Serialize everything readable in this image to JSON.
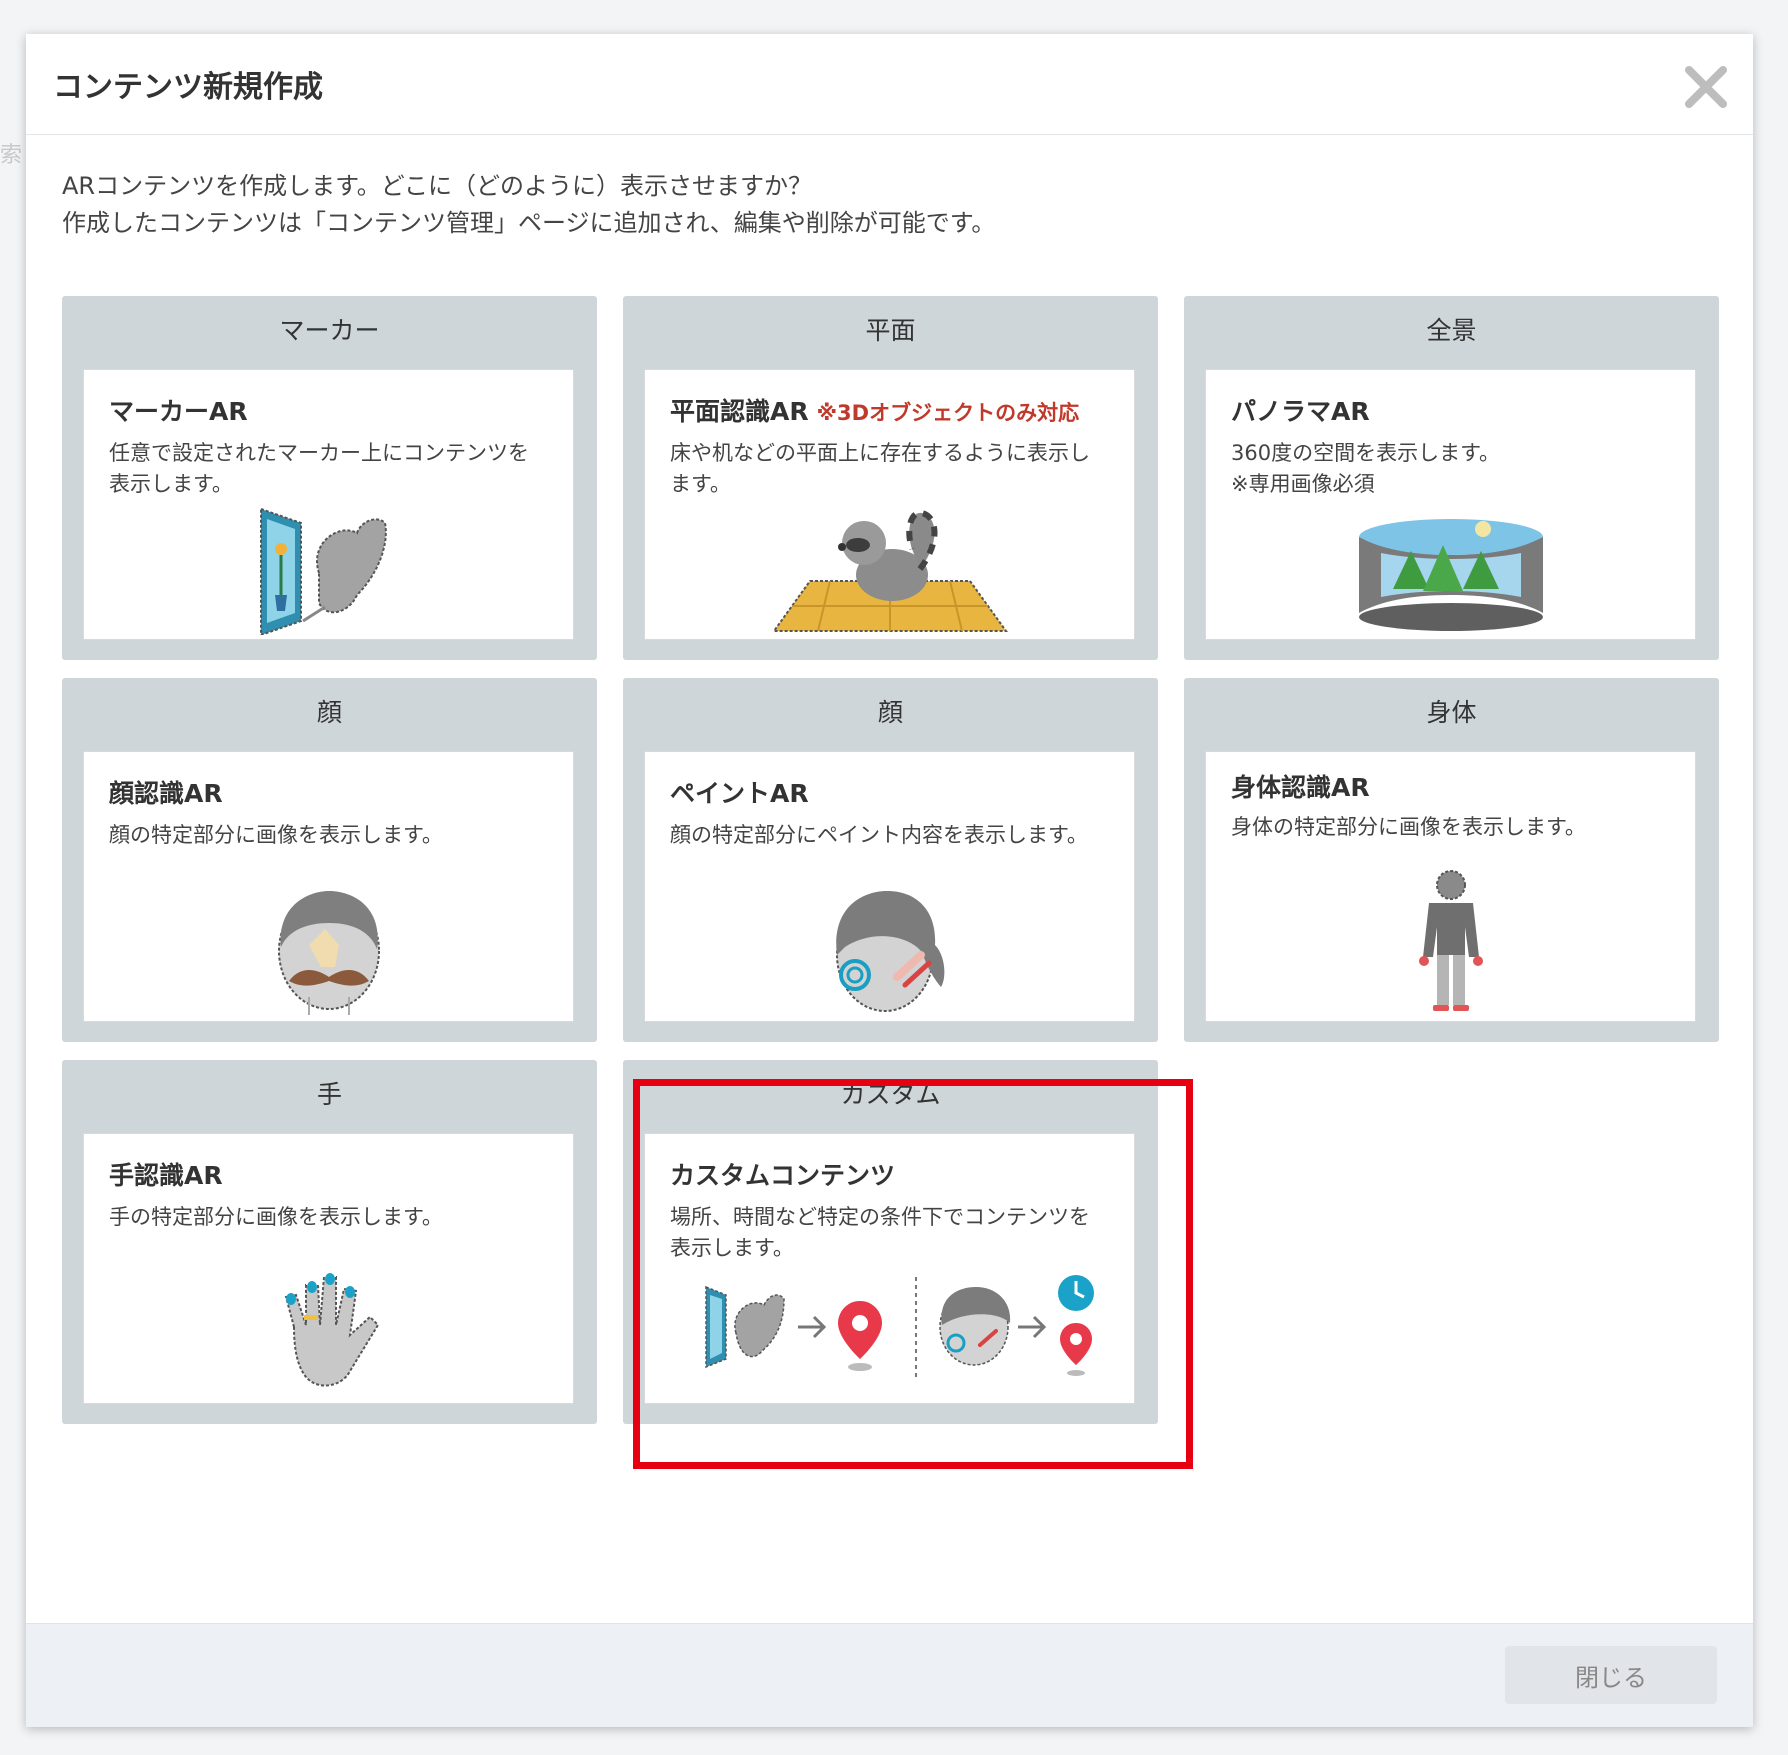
{
  "background": {
    "fragment": "索"
  },
  "dialog": {
    "title": "コンテンツ新規作成",
    "intro_line1": "ARコンテンツを作成します。どこに（どのように）表示させますか？",
    "intro_line2": "作成したコンテンツは「コンテンツ管理」ページに追加され、編集や削除が可能です。",
    "close_label": "閉じる"
  },
  "cards": [
    {
      "category": "マーカー",
      "title": "マーカーAR",
      "note": "",
      "desc": "任意で設定されたマーカー上にコンテンツを表示します。"
    },
    {
      "category": "平面",
      "title": "平面認識AR",
      "note": "※3Dオブジェクトのみ対応",
      "desc": "床や机などの平面上に存在するように表示します。"
    },
    {
      "category": "全景",
      "title": "パノラマAR",
      "note": "",
      "desc": "360度の空間を表示します。",
      "desc2": "※専用画像必須"
    },
    {
      "category": "顔",
      "title": "顔認識AR",
      "note": "",
      "desc": "顔の特定部分に画像を表示します。"
    },
    {
      "category": "顔",
      "title": "ペイントAR",
      "note": "",
      "desc": "顔の特定部分にペイント内容を表示します。"
    },
    {
      "category": "身体",
      "title": "身体認識AR",
      "note": "",
      "desc": "身体の特定部分に画像を表示します。"
    },
    {
      "category": "手",
      "title": "手認識AR",
      "note": "",
      "desc": "手の特定部分に画像を表示します。"
    },
    {
      "category": "カスタム",
      "title": "カスタムコンテンツ",
      "note": "",
      "desc": "場所、時間など特定の条件下でコンテンツを表示します。"
    }
  ],
  "colors": {
    "highlight": "#e60012",
    "card_bg": "#cfd6da",
    "note": "#c0392b"
  },
  "icons": [
    "close-icon",
    "marker-butterfly-icon",
    "raccoon-floor-icon",
    "panorama-icon",
    "face-mustache-icon",
    "face-paint-icon",
    "body-icon",
    "hand-icon",
    "custom-flow-icon"
  ]
}
